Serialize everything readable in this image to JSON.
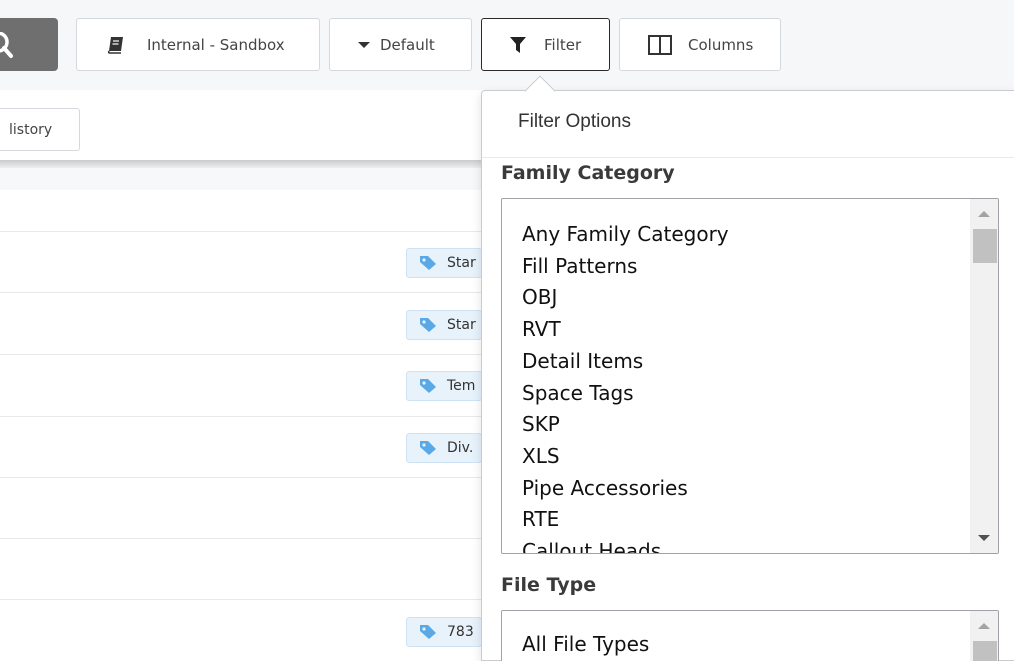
{
  "toolbar": {
    "search_icon": "search-icon",
    "workspace_label": "Internal - Sandbox",
    "workspace_icon": "book-icon",
    "view_label": "Default",
    "view_icon": "caret-down-icon",
    "filter_label": "Filter",
    "filter_icon": "funnel-icon",
    "columns_label": "Columns",
    "columns_icon": "columns-icon"
  },
  "history_label": "listory",
  "rows": [
    {
      "tag": "Star"
    },
    {
      "tag": "Star"
    },
    {
      "tag": "Tem"
    },
    {
      "tag": "Div."
    },
    {
      "tag": ""
    },
    {
      "tag": ""
    },
    {
      "tag": "783"
    }
  ],
  "filter_popover": {
    "title": "Filter Options",
    "family_category": {
      "label": "Family Category",
      "options": [
        "Any Family Category",
        "Fill Patterns",
        "OBJ",
        "RVT",
        "Detail Items",
        "Space Tags",
        "SKP",
        "XLS",
        "Pipe Accessories",
        "RTE",
        "Callout Heads"
      ]
    },
    "file_type": {
      "label": "File Type",
      "options": [
        "All File Types"
      ]
    }
  },
  "colors": {
    "tag_bg": "#e7f2fb",
    "tag_icon": "#5aa9e6",
    "toolbar_bg": "#f6f7f8",
    "search_button": "#6f6f6f"
  }
}
